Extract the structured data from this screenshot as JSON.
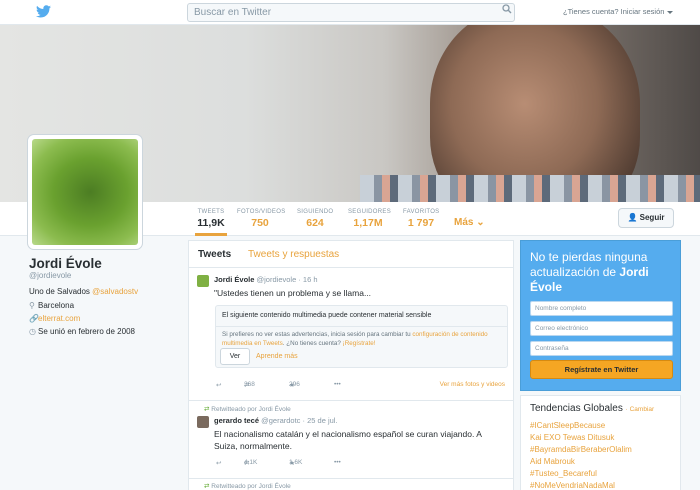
{
  "topbar": {
    "search_placeholder": "Buscar en Twitter",
    "account_link": "¿Tienes cuenta? Iniciar sesión"
  },
  "profile": {
    "name": "Jordi Évole",
    "handle": "@jordievole",
    "bio_prefix": "Uno de Salvados ",
    "bio_link": "@salvadostv",
    "location": "Barcelona",
    "website": "elterrat.com",
    "joined": "Se unió en febrero de 2008"
  },
  "stats": [
    {
      "label": "TWEETS",
      "value": "11,9K"
    },
    {
      "label": "FOTOS/VIDEOS",
      "value": "750"
    },
    {
      "label": "SIGUIENDO",
      "value": "624"
    },
    {
      "label": "SEGUIDORES",
      "value": "1,17M"
    },
    {
      "label": "FAVORITOS",
      "value": "1 797"
    }
  ],
  "more_label": "Más",
  "follow_label": "Seguir",
  "timeline": {
    "tabs": [
      "Tweets",
      "Tweets y respuestas"
    ],
    "tweets": [
      {
        "author": "Jordi Évole",
        "handle": "@jordievole",
        "time": "· 16 h",
        "text": "\"Ustedes tienen un problema y se llama...",
        "media_warning": "El siguiente contenido multimedia puede contener material sensible",
        "media_note_prefix": "Si prefieres no ver estas advertencias, inicia sesión para cambiar tu ",
        "media_note_link": "configuración de contenido multimedia en Tweets",
        "media_note_mid": ". ¿No tienes cuenta? ",
        "media_note_link2": "¡Regístrate!",
        "view_label": "Ver",
        "learn_label": "Aprende más",
        "retweets": "368",
        "favorites": "296",
        "more_media": "Ver más fotos y videos"
      },
      {
        "retweeted_by": "Retwitteado por Jordi Évole",
        "author": "gerardo tecé",
        "handle": "@gerardotc",
        "time": "· 25 de jul.",
        "text": "El nacionalismo catalán y el nacionalismo español se curan viajando. A Suiza, normalmente.",
        "retweets": "4,1K",
        "favorites": "1,6K"
      },
      {
        "retweeted_by": "Retwitteado por Jordi Évole"
      }
    ]
  },
  "signup": {
    "headline": "No te pierdas ninguna actualización de ",
    "headline_name": "Jordi Évole",
    "name_placeholder": "Nombre completo",
    "email_placeholder": "Correo electrónico",
    "password_placeholder": "Contraseña",
    "button": "Regístrate en Twitter"
  },
  "trends": {
    "title": "Tendencias Globales",
    "change": "· Cambiar",
    "items": [
      "#ICantSleepBecause",
      "Kai EXO Tewas Ditusuk",
      "#BayramdaBirBeraberOlalim",
      "Aid Mabrouk",
      "#Tusteo_Becareful",
      "#NoMeVendriaNadaMal"
    ]
  },
  "colors": {
    "accent": "#e8a33d",
    "signup_bg": "#55acee",
    "retweet_green": "#5fa92f"
  }
}
